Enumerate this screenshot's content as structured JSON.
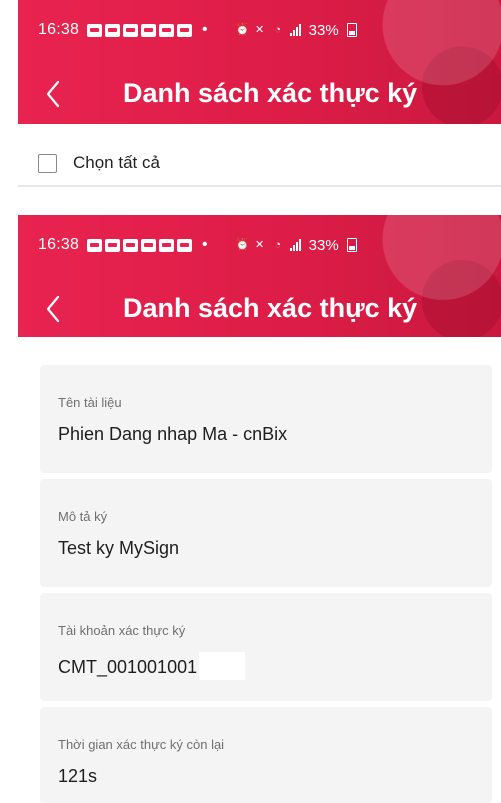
{
  "status_bar": {
    "time": "16:38",
    "battery": "33%"
  },
  "header": {
    "title": "Danh sách xác thực ký"
  },
  "select_all": {
    "label": "Chọn tất cả",
    "checked": false
  },
  "fields": [
    {
      "label": "Tên tài liệu",
      "value": "Phien Dang nhap Ma - cnBix"
    },
    {
      "label": "Mô tả ký",
      "value": "Test ky MySign"
    },
    {
      "label": "Tài khoản xác thực ký",
      "value": "CMT_001001001"
    },
    {
      "label": "Thời gian xác thực ký còn lại",
      "value": "121s"
    }
  ],
  "colors": {
    "header_red": "#e8234f",
    "card_bg": "#f4f4f4"
  },
  "icons": {
    "back": "chevron-left-icon",
    "checkbox": "checkbox-unchecked-icon"
  }
}
